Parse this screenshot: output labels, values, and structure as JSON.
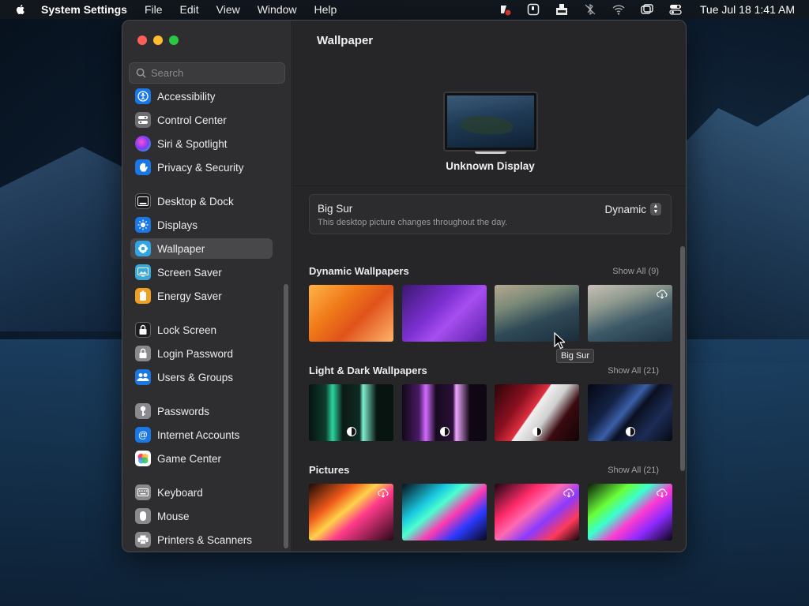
{
  "menubar": {
    "app_name": "System Settings",
    "menus": [
      "File",
      "Edit",
      "View",
      "Window",
      "Help"
    ],
    "status_icons": [
      "app-badge-icon",
      "screen-record-icon",
      "input-icon",
      "bluetooth-off-icon",
      "wifi-icon",
      "screen-mirroring-icon",
      "control-center-icon"
    ],
    "clock": "Tue Jul 18  1:41 AM"
  },
  "sidebar": {
    "search_placeholder": "Search",
    "items": [
      {
        "label": "Accessibility",
        "icon": "accessibility-icon",
        "color": "#1a78e6"
      },
      {
        "label": "Control Center",
        "icon": "control-center-icon",
        "color": "#6e6e72"
      },
      {
        "label": "Siri & Spotlight",
        "icon": "siri-icon",
        "color": "#8a3ad6"
      },
      {
        "label": "Privacy & Security",
        "icon": "hand-icon",
        "color": "#1a78e6"
      },
      {
        "label": "Desktop & Dock",
        "icon": "dock-icon",
        "color": "#1c1c1e"
      },
      {
        "label": "Displays",
        "icon": "sun-icon",
        "color": "#1a78e6"
      },
      {
        "label": "Wallpaper",
        "icon": "wallpaper-icon",
        "color": "#2fa5e8"
      },
      {
        "label": "Screen Saver",
        "icon": "screen-saver-icon",
        "color": "#3aa9d9"
      },
      {
        "label": "Energy Saver",
        "icon": "battery-icon",
        "color": "#f0a020"
      },
      {
        "label": "Lock Screen",
        "icon": "lock-icon",
        "color": "#1c1c1e"
      },
      {
        "label": "Login Password",
        "icon": "lock-icon",
        "color": "#8a8a8e"
      },
      {
        "label": "Users & Groups",
        "icon": "users-icon",
        "color": "#1a78e6"
      },
      {
        "label": "Passwords",
        "icon": "key-icon",
        "color": "#8a8a8e"
      },
      {
        "label": "Internet Accounts",
        "icon": "at-icon",
        "color": "#1a78e6"
      },
      {
        "label": "Game Center",
        "icon": "game-center-icon",
        "color": "#ffffff"
      },
      {
        "label": "Keyboard",
        "icon": "keyboard-icon",
        "color": "#8a8a8e"
      },
      {
        "label": "Mouse",
        "icon": "mouse-icon",
        "color": "#8a8a8e"
      },
      {
        "label": "Printers & Scanners",
        "icon": "printer-icon",
        "color": "#8a8a8e"
      }
    ]
  },
  "main": {
    "title": "Wallpaper",
    "display_name": "Unknown Display",
    "current": {
      "name": "Big Sur",
      "description": "This desktop picture changes throughout the day.",
      "mode": "Dynamic"
    },
    "sections": [
      {
        "title": "Dynamic Wallpapers",
        "show_all": "Show All (9)"
      },
      {
        "title": "Light & Dark Wallpapers",
        "show_all": "Show All (21)"
      },
      {
        "title": "Pictures",
        "show_all": "Show All (21)"
      }
    ],
    "tooltip": "Big Sur"
  }
}
